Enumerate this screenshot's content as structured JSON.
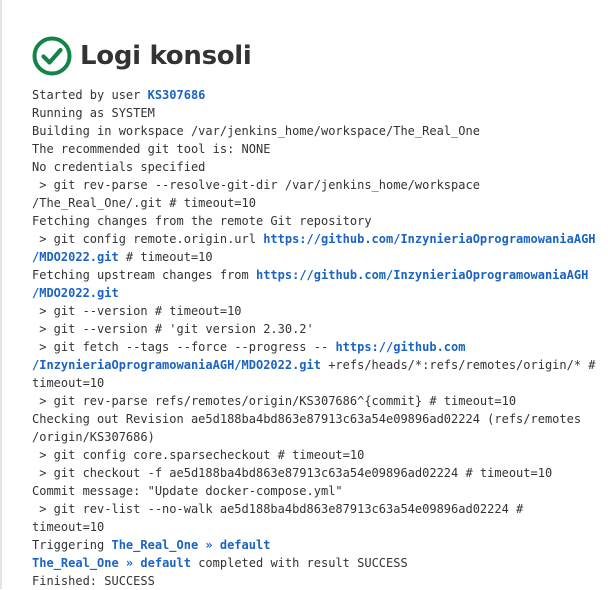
{
  "page": {
    "title": "Logi konsoli"
  },
  "console": {
    "lines": [
      [
        {
          "t": "Started by user "
        },
        {
          "t": "KS307686",
          "link": true,
          "name": "user-link"
        }
      ],
      [
        {
          "t": "Running as SYSTEM"
        }
      ],
      [
        {
          "t": "Building in workspace /var/jenkins_home/workspace/The_Real_One"
        }
      ],
      [
        {
          "t": "The recommended git tool is: NONE"
        }
      ],
      [
        {
          "t": "No credentials specified"
        }
      ],
      [
        {
          "t": " > git rev-parse --resolve-git-dir /var/jenkins_home/workspace"
        }
      ],
      [
        {
          "t": "/The_Real_One/.git # timeout=10"
        }
      ],
      [
        {
          "t": "Fetching changes from the remote Git repository"
        }
      ],
      [
        {
          "t": " > git config remote.origin.url "
        },
        {
          "t": "https://github.com/InzynieriaOprogramowaniaAGH",
          "link": true,
          "name": "repo-link"
        }
      ],
      [
        {
          "t": "/MDO2022.git",
          "link": true,
          "name": "repo-link"
        },
        {
          "t": " # timeout=10"
        }
      ],
      [
        {
          "t": "Fetching upstream changes from "
        },
        {
          "t": "https://github.com/InzynieriaOprogramowaniaAGH",
          "link": true,
          "name": "repo-link"
        }
      ],
      [
        {
          "t": "/MDO2022.git",
          "link": true,
          "name": "repo-link"
        }
      ],
      [
        {
          "t": " > git --version # timeout=10"
        }
      ],
      [
        {
          "t": " > git --version # 'git version 2.30.2'"
        }
      ],
      [
        {
          "t": " > git fetch --tags --force --progress -- "
        },
        {
          "t": "https://github.com",
          "link": true,
          "name": "repo-link"
        }
      ],
      [
        {
          "t": "/InzynieriaOprogramowaniaAGH/MDO2022.git",
          "link": true,
          "name": "repo-link"
        },
        {
          "t": " +refs/heads/*:refs/remotes/origin/* #"
        }
      ],
      [
        {
          "t": "timeout=10"
        }
      ],
      [
        {
          "t": " > git rev-parse refs/remotes/origin/KS307686^{commit} # timeout=10"
        }
      ],
      [
        {
          "t": "Checking out Revision ae5d188ba4bd863e87913c63a54e09896ad02224 (refs/remotes"
        }
      ],
      [
        {
          "t": "/origin/KS307686)"
        }
      ],
      [
        {
          "t": " > git config core.sparsecheckout # timeout=10"
        }
      ],
      [
        {
          "t": " > git checkout -f ae5d188ba4bd863e87913c63a54e09896ad02224 # timeout=10"
        }
      ],
      [
        {
          "t": "Commit message: \"Update docker-compose.yml\""
        }
      ],
      [
        {
          "t": " > git rev-list --no-walk ae5d188ba4bd863e87913c63a54e09896ad02224 #"
        }
      ],
      [
        {
          "t": "timeout=10"
        }
      ],
      [
        {
          "t": "Triggering "
        },
        {
          "t": "The_Real_One » default",
          "link": true,
          "name": "job-link"
        }
      ],
      [
        {
          "t": "The_Real_One",
          "link": true,
          "name": "job-link"
        },
        {
          "t": " » ",
          "link": true,
          "name": "job-link-separator"
        },
        {
          "t": "default",
          "link": true,
          "name": "job-link"
        },
        {
          "t": " completed with result SUCCESS"
        }
      ],
      [
        {
          "t": "Finished: SUCCESS"
        }
      ]
    ]
  },
  "icons": {
    "status": "success-check-icon"
  },
  "colors": {
    "success": "#138347",
    "link": "#1b63c4",
    "text": "#333333"
  }
}
